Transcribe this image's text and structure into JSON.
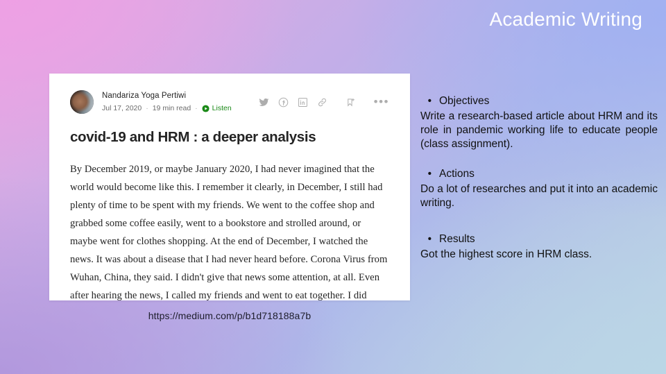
{
  "slide": {
    "title": "Academic Writing",
    "background_colors": {
      "top_left": "#e7a9e2",
      "top_right": "#aeb9ea",
      "bottom_left": "#b096dc",
      "bottom_right": "#bcd3e3"
    }
  },
  "article_card": {
    "author": "Nandariza Yoga Pertiwi",
    "date": "Jul 17, 2020",
    "read_time": "19 min read",
    "separator": "·",
    "listen_label": "Listen",
    "listen_color": "#1a8917",
    "title": "covid-19 and HRM : a deeper analysis",
    "body": "By December 2019, or maybe January 2020, I had never imagined that the world would become like this. I remember it clearly, in December, I still had plenty of time to be spent with my friends. We went to the coffee shop and grabbed some coffee easily, went to a bookstore and strolled around, or maybe went for clothes shopping. At the end of December, I watched the news. It was about a disease that I had never heard before. Corona Virus from Wuhan, China, they said. I didn't give that news some attention, at all. Even after hearing the news, I called my friends and went to eat together. I did really concerned and confused, of course. However, my careless self told me.",
    "more_menu": "•••",
    "icons": [
      "twitter-icon",
      "facebook-icon",
      "linkedin-icon",
      "link-icon",
      "bookmark-add-icon",
      "more-options-icon"
    ]
  },
  "url_caption": "https://medium.com/p/b1d718188a7b",
  "info_panel": {
    "bullet": "•",
    "sections": [
      {
        "heading": "Objectives",
        "text": "Write a research-based article about HRM and its role in pandemic working life to educate people (class assignment)."
      },
      {
        "heading": "Actions",
        "text": "Do a lot of researches and put it into an academic writing."
      },
      {
        "heading": "Results",
        "text": "Got the highest score in HRM class."
      }
    ]
  }
}
